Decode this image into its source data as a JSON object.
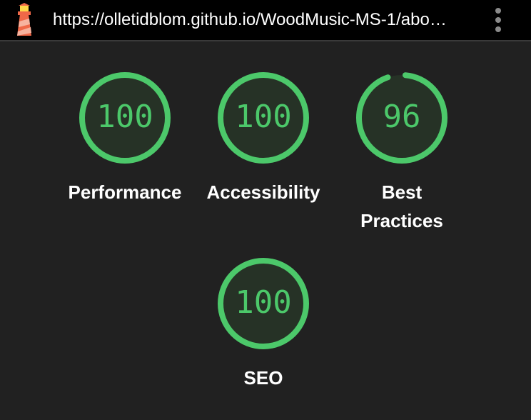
{
  "header": {
    "url": "https://olletidblom.github.io/WoodMusic-MS-1/abo…",
    "logo_icon": "lighthouse-icon",
    "menu_icon": "kebab-menu-icon"
  },
  "colors": {
    "pass": "#4cc86a",
    "gauge_bg": "#263226",
    "page_bg": "#212121",
    "header_bg": "#000000"
  },
  "categories": [
    {
      "label": "Performance",
      "score": "100",
      "fraction": 1.0
    },
    {
      "label": "Accessibility",
      "score": "100",
      "fraction": 1.0
    },
    {
      "label": "Best Practices",
      "score": "96",
      "fraction": 0.96
    },
    {
      "label": "SEO",
      "score": "100",
      "fraction": 1.0
    }
  ]
}
